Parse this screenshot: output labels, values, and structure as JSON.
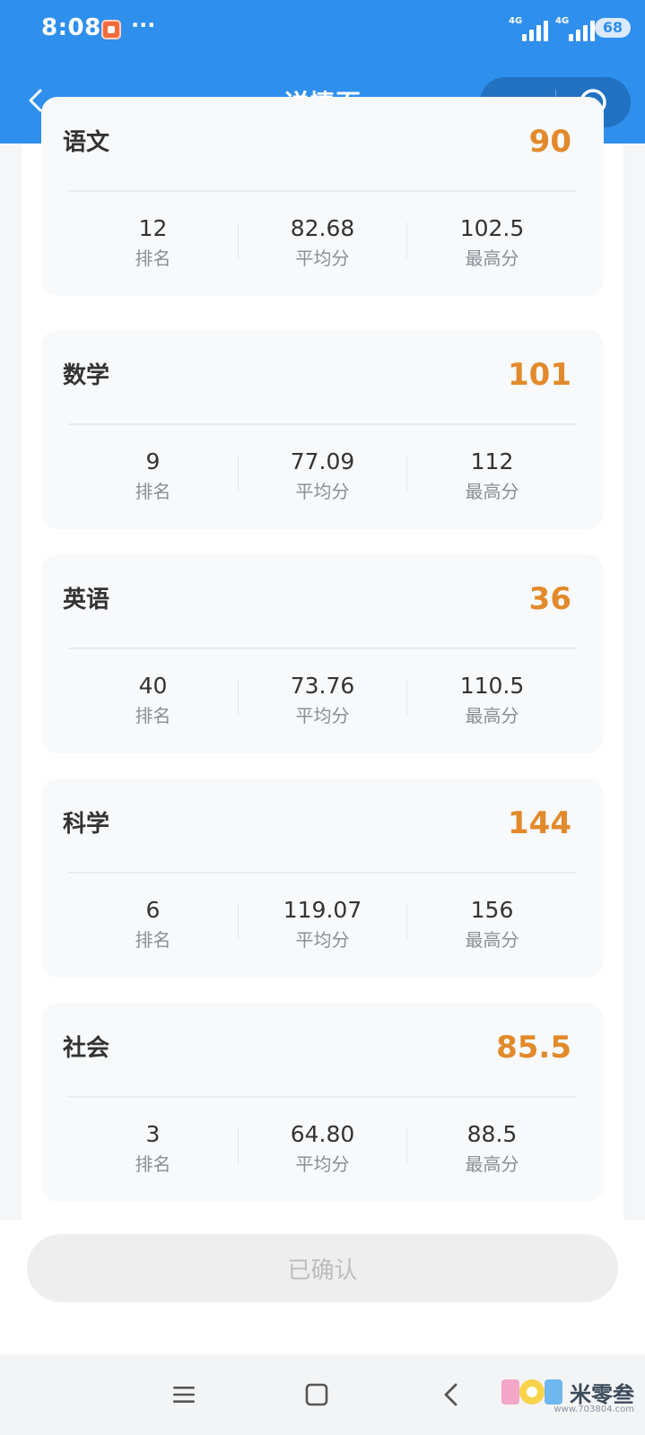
{
  "status_bar": {
    "time": "8:08",
    "more": "···",
    "network_1": "4G",
    "network_2": "4G",
    "battery": "68"
  },
  "header": {
    "title": "详情页"
  },
  "subjects": [
    {
      "name": "语文",
      "score": "90",
      "rank": "12",
      "avg": "82.68",
      "max": "102.5"
    },
    {
      "name": "数学",
      "score": "101",
      "rank": "9",
      "avg": "77.09",
      "max": "112"
    },
    {
      "name": "英语",
      "score": "36",
      "rank": "40",
      "avg": "73.76",
      "max": "110.5"
    },
    {
      "name": "科学",
      "score": "144",
      "rank": "6",
      "avg": "119.07",
      "max": "156"
    },
    {
      "name": "社会",
      "score": "85.5",
      "rank": "3",
      "avg": "64.80",
      "max": "88.5"
    }
  ],
  "labels": {
    "rank": "排名",
    "avg": "平均分",
    "max": "最高分"
  },
  "confirm_button": "已确认",
  "watermark": {
    "text": "米零叁",
    "sub": "www.703804.com"
  },
  "colors": {
    "header": "#2f8fec",
    "score": "#e28a2b"
  }
}
